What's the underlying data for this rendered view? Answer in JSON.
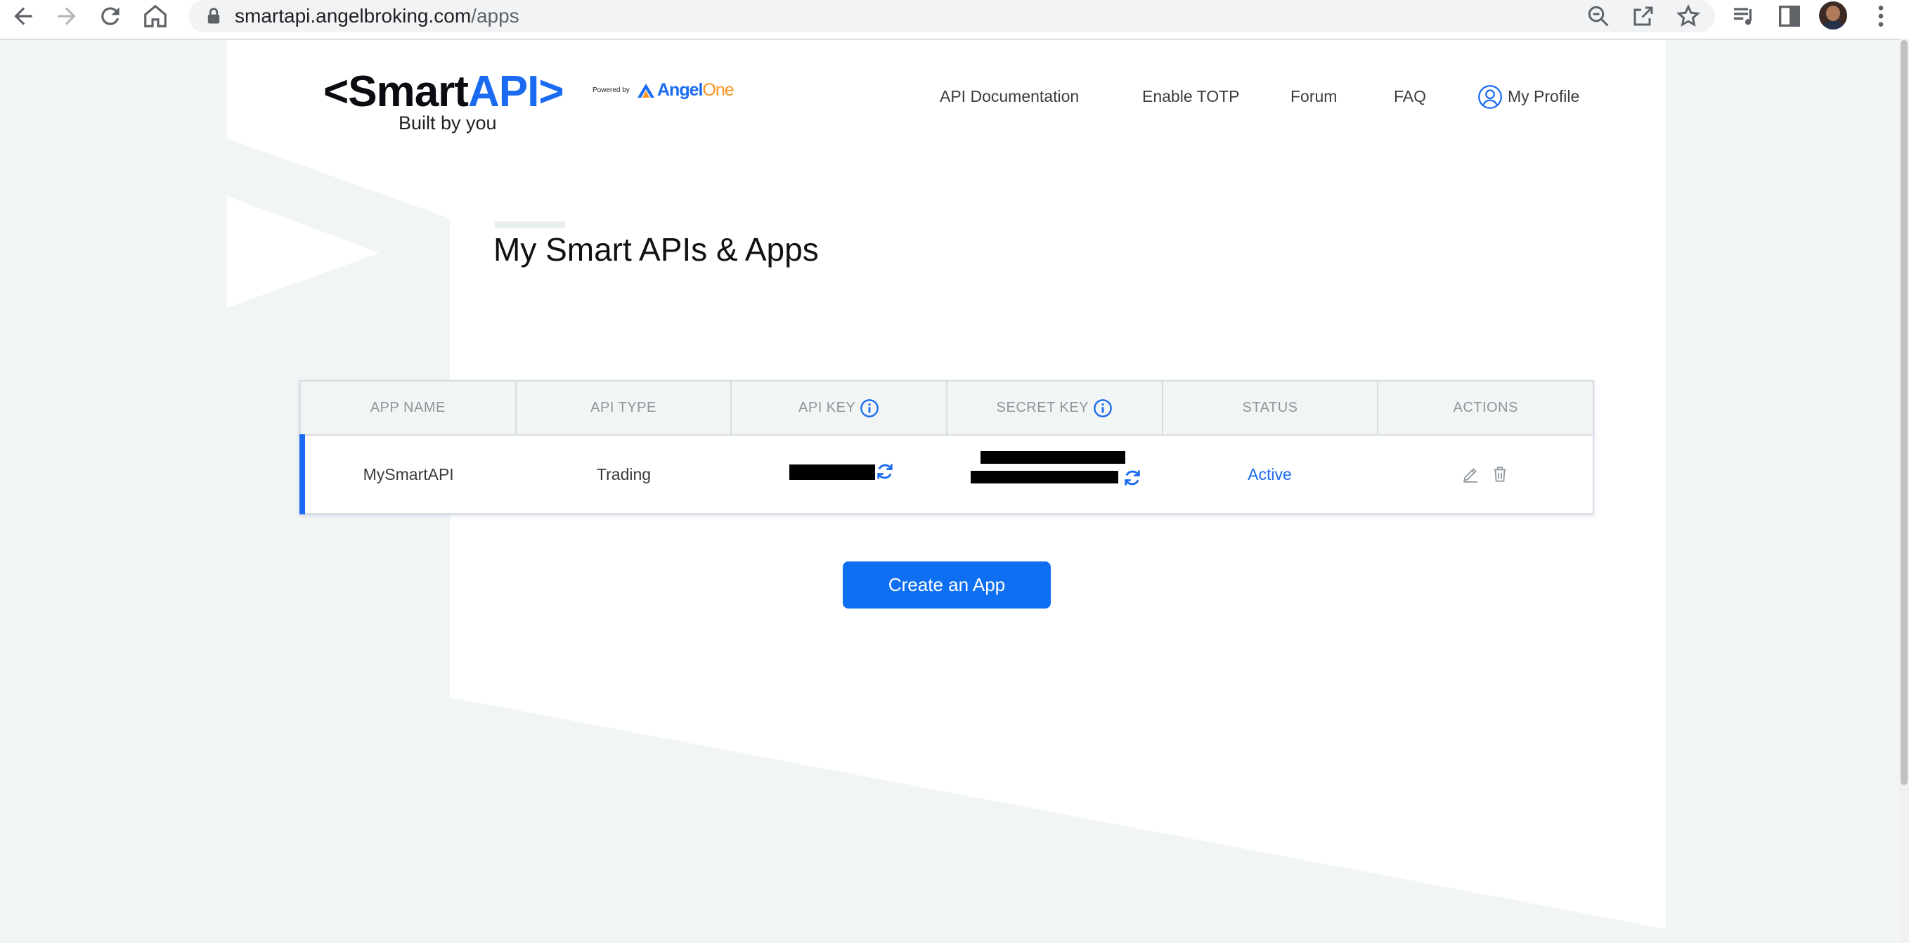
{
  "browser": {
    "url_domain": "smartapi.angelbroking.com",
    "url_path": "/apps"
  },
  "header": {
    "logo_prefix": "<Smart",
    "logo_highlight": "API",
    "logo_suffix": ">",
    "tagline": "Built by you",
    "powered_by": "Powered by",
    "angel_brand": "Angel",
    "angel_brand_suffix": "One",
    "nav": {
      "api_docs": "API Documentation",
      "enable_totp": "Enable TOTP",
      "forum": "Forum",
      "faq": "FAQ",
      "profile": "My Profile"
    }
  },
  "main": {
    "title": "My Smart APIs & Apps",
    "table": {
      "headers": {
        "app_name": "APP NAME",
        "api_type": "API TYPE",
        "api_key": "API KEY",
        "secret_key": "SECRET KEY",
        "status": "STATUS",
        "actions": "ACTIONS"
      },
      "rows": [
        {
          "app_name": "MySmartAPI",
          "api_type": "Trading",
          "status": "Active"
        }
      ]
    },
    "create_button": "Create an App"
  },
  "colors": {
    "accent": "#1a6bf2",
    "button": "#0e6ff2",
    "page_background": "#f1f5f4",
    "angel_orange": "#f7941d"
  },
  "icons": {
    "back": "arrow-left",
    "forward": "arrow-right",
    "reload": "refresh",
    "home": "house",
    "lock": "padlock",
    "zoom": "magnifier-minus",
    "share": "share-box-arrow",
    "bookmark": "star",
    "media": "music-queue",
    "sidepanel": "side-panel",
    "menu": "kebab-dots",
    "profile": "user-circle",
    "info": "info-circle",
    "refresh_key": "circular-arrows",
    "edit": "pencil",
    "delete": "trash-can"
  }
}
